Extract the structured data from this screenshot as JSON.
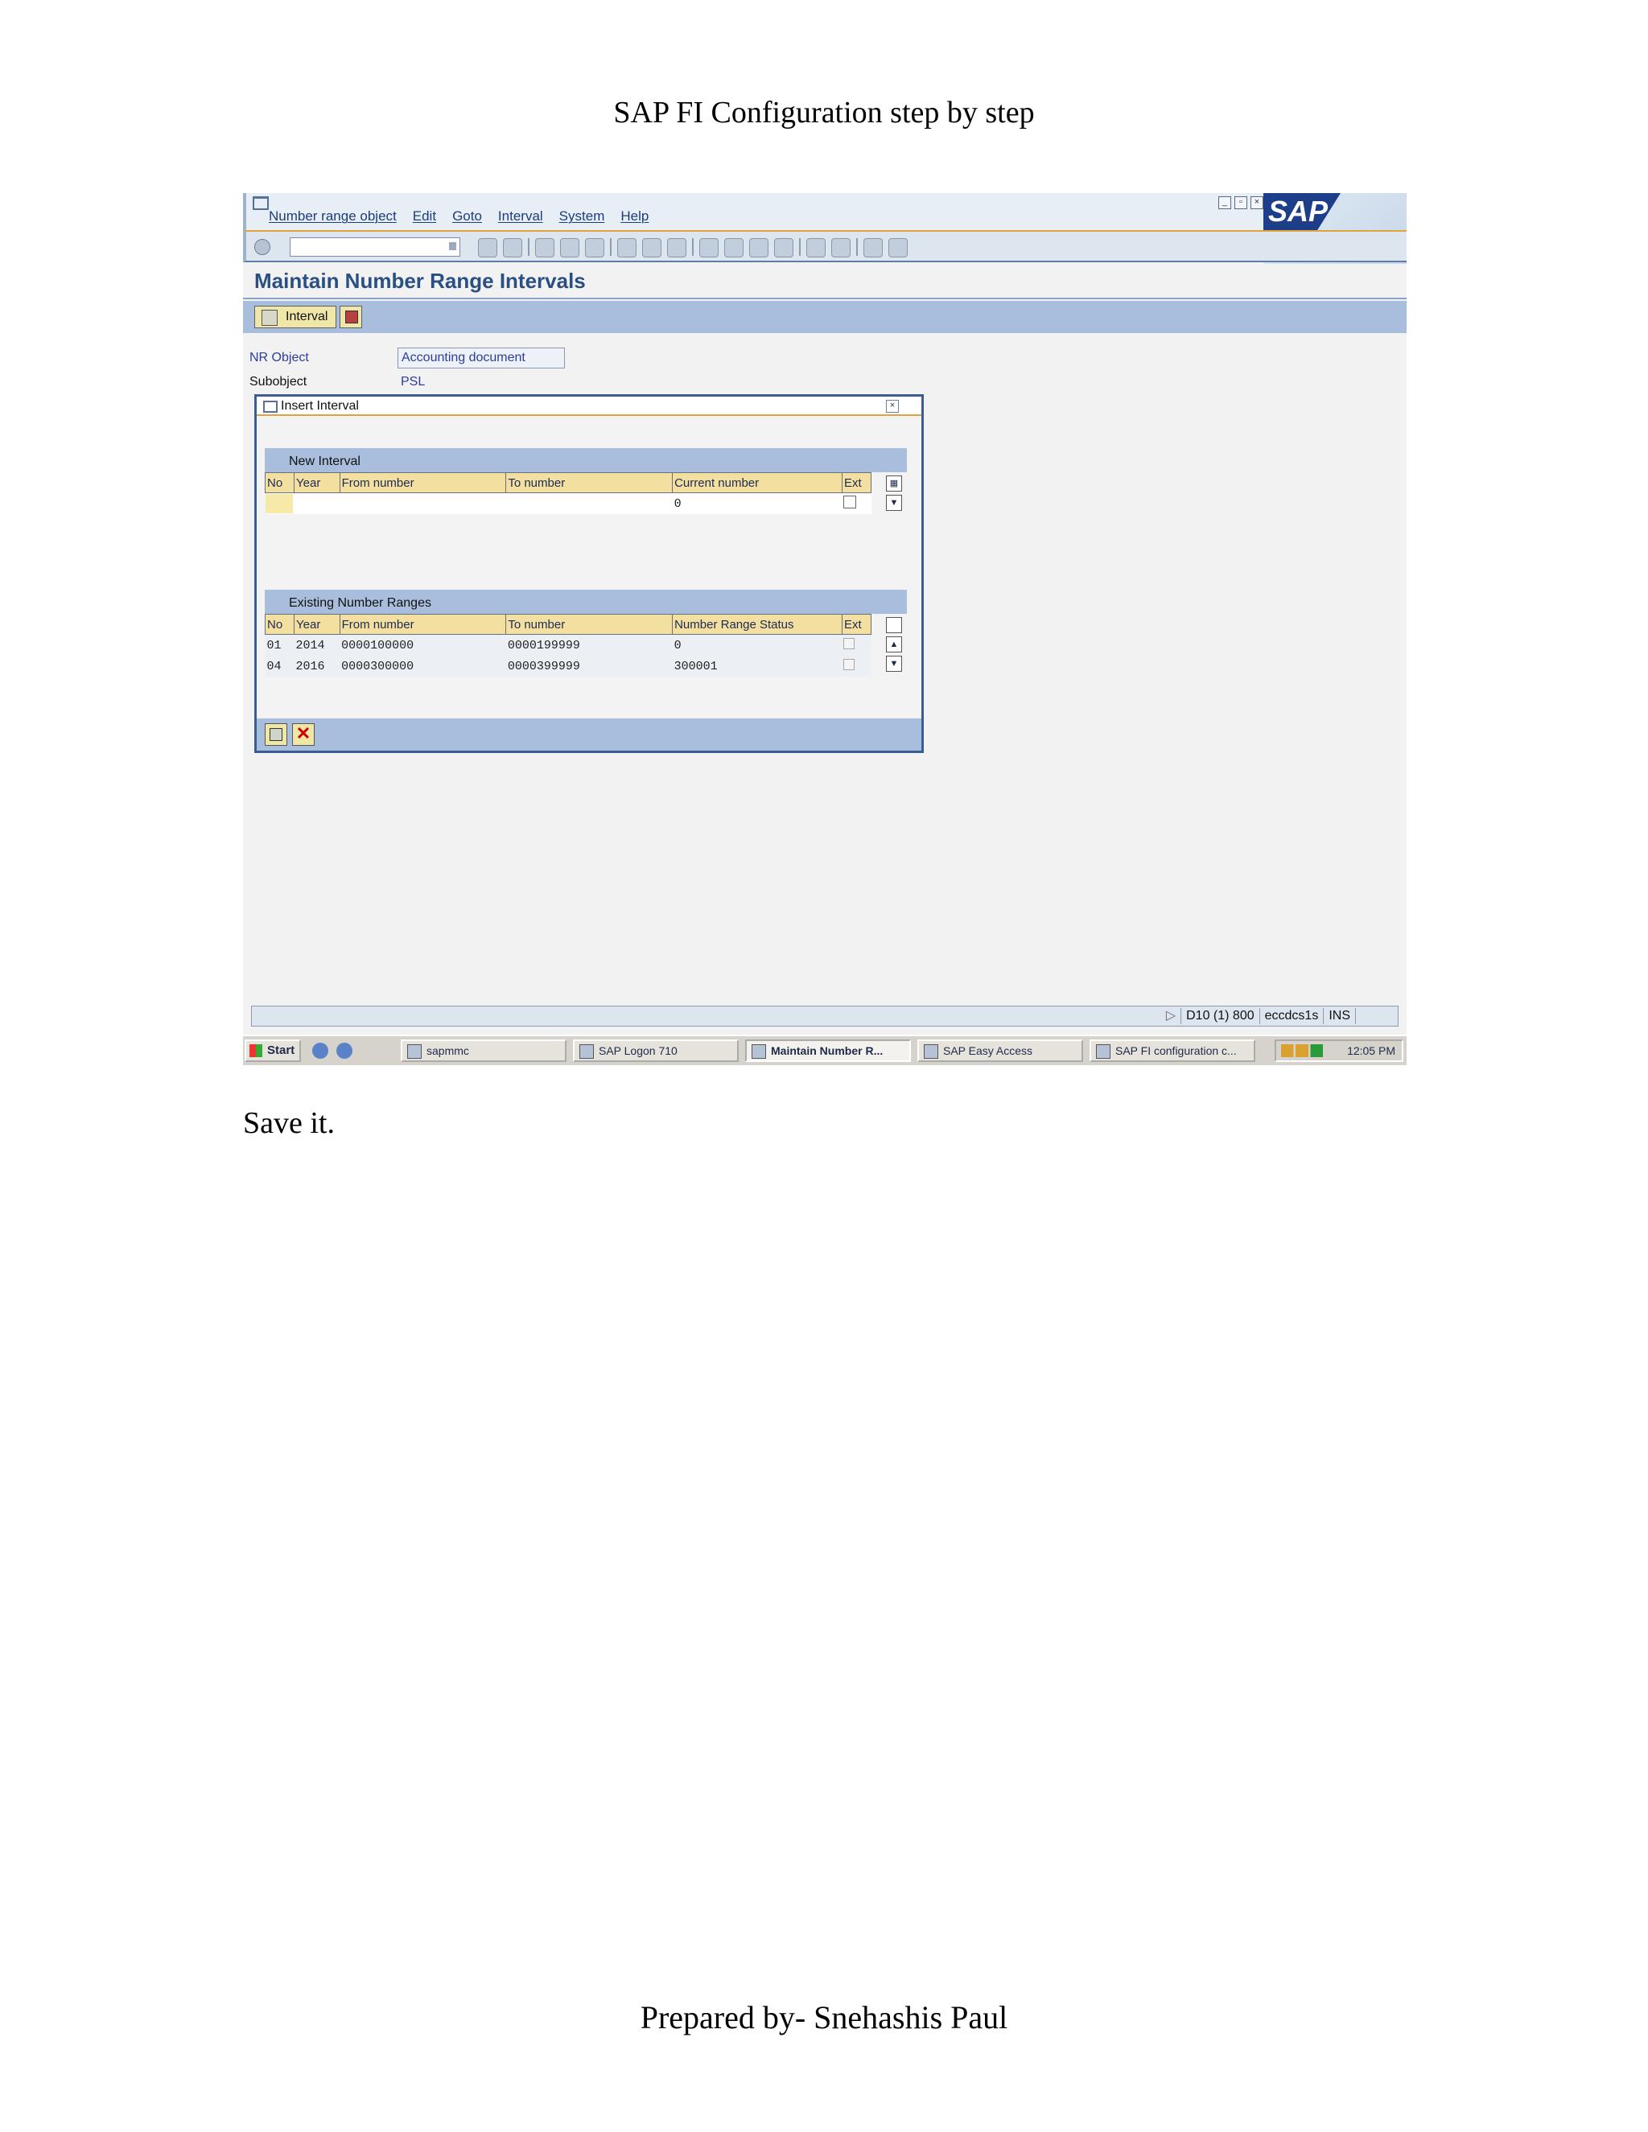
{
  "doc": {
    "title": "SAP FI Configuration step by step",
    "caption": "Save it.",
    "footer": "Prepared by- Snehashis Paul"
  },
  "window": {
    "menu": [
      "Number range object",
      "Edit",
      "Goto",
      "Interval",
      "System",
      "Help"
    ],
    "page_title": "Maintain Number Range Intervals",
    "interval_button": "Interval",
    "logo_text": "SAP"
  },
  "header_fields": {
    "nr_object_label": "NR Object",
    "nr_object_value": "Accounting document",
    "subobject_label": "Subobject",
    "subobject_value": "PSL"
  },
  "dialog": {
    "title": "Insert Interval",
    "new_interval": {
      "heading": "New Interval",
      "columns": [
        "No",
        "Year",
        "From number",
        "To number",
        "Current number",
        "Ext"
      ],
      "row": {
        "no": "",
        "year": "",
        "from": "",
        "to": "",
        "current": "0"
      }
    },
    "existing": {
      "heading": "Existing Number Ranges",
      "columns": [
        "No",
        "Year",
        "From number",
        "To number",
        "Number Range Status",
        "Ext"
      ],
      "rows": [
        {
          "no": "01",
          "year": "2014",
          "from": "0000100000",
          "to": "0000199999",
          "status": "0"
        },
        {
          "no": "04",
          "year": "2016",
          "from": "0000300000",
          "to": "0000399999",
          "status": "300001"
        }
      ]
    }
  },
  "statusbar": {
    "system": "D10 (1) 800",
    "server": "eccdcs1s",
    "mode": "INS"
  },
  "taskbar": {
    "start": "Start",
    "tasks": [
      "sapmmc",
      "SAP Logon 710",
      "Maintain Number R...",
      "SAP Easy Access",
      "SAP FI configuration c..."
    ],
    "clock": "12:05 PM"
  }
}
